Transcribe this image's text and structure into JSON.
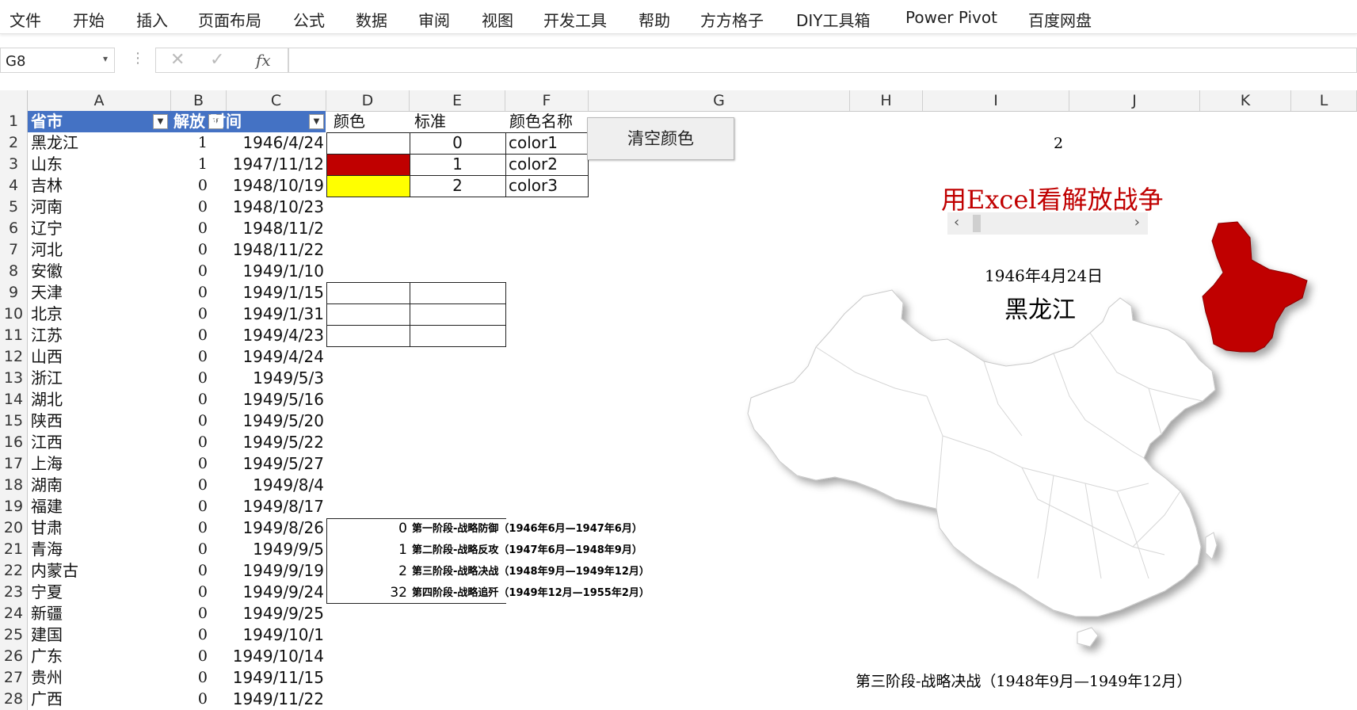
{
  "ribbon": {
    "tabs": [
      "文件",
      "开始",
      "插入",
      "页面布局",
      "公式",
      "数据",
      "审阅",
      "视图",
      "开发工具",
      "帮助",
      "方方格子",
      "DIY工具箱",
      "Power Pivot",
      "百度网盘"
    ]
  },
  "formula_bar": {
    "name_box": "G8",
    "fx": "fx",
    "formula": ""
  },
  "columns": [
    "A",
    "B",
    "C",
    "D",
    "E",
    "F",
    "G",
    "H",
    "I",
    "J",
    "K",
    "L"
  ],
  "rows": [
    "1",
    "2",
    "3",
    "4",
    "5",
    "6",
    "7",
    "8",
    "9",
    "10",
    "11",
    "12",
    "13",
    "14",
    "15",
    "16",
    "17",
    "18",
    "19",
    "20",
    "21",
    "22",
    "23",
    "24",
    "25",
    "26",
    "27",
    "28"
  ],
  "table": {
    "headers": [
      "省市",
      "解放",
      "时间",
      "颜色",
      "标准",
      "颜色名称"
    ],
    "data": [
      [
        "黑龙江",
        "1",
        "1946/4/24"
      ],
      [
        "山东",
        "1",
        "1947/11/12"
      ],
      [
        "吉林",
        "0",
        "1948/10/19"
      ],
      [
        "河南",
        "0",
        "1948/10/23"
      ],
      [
        "辽宁",
        "0",
        "1948/11/2"
      ],
      [
        "河北",
        "0",
        "1948/11/22"
      ],
      [
        "安徽",
        "0",
        "1949/1/10"
      ],
      [
        "天津",
        "0",
        "1949/1/15"
      ],
      [
        "北京",
        "0",
        "1949/1/31"
      ],
      [
        "江苏",
        "0",
        "1949/4/23"
      ],
      [
        "山西",
        "0",
        "1949/4/24"
      ],
      [
        "浙江",
        "0",
        "1949/5/3"
      ],
      [
        "湖北",
        "0",
        "1949/5/16"
      ],
      [
        "陕西",
        "0",
        "1949/5/20"
      ],
      [
        "江西",
        "0",
        "1949/5/22"
      ],
      [
        "上海",
        "0",
        "1949/5/27"
      ],
      [
        "湖南",
        "0",
        "1949/8/4"
      ],
      [
        "福建",
        "0",
        "1949/8/17"
      ],
      [
        "甘肃",
        "0",
        "1949/8/26"
      ],
      [
        "青海",
        "0",
        "1949/9/5"
      ],
      [
        "内蒙古",
        "0",
        "1949/9/19"
      ],
      [
        "宁夏",
        "0",
        "1949/9/24"
      ],
      [
        "新疆",
        "0",
        "1949/9/25"
      ],
      [
        "建国",
        "0",
        "1949/10/1"
      ],
      [
        "广东",
        "0",
        "1949/10/14"
      ],
      [
        "贵州",
        "0",
        "1949/11/15"
      ],
      [
        "广西",
        "0",
        "1949/11/22"
      ]
    ]
  },
  "color_table": {
    "rows": [
      {
        "standard": "0",
        "name": "color1",
        "fill": "#ffffff"
      },
      {
        "standard": "1",
        "name": "color2",
        "fill": "#c00000"
      },
      {
        "standard": "2",
        "name": "color3",
        "fill": "#ffff00"
      }
    ]
  },
  "stages": [
    {
      "value": "0",
      "label": "第一阶段-战略防御（1946年6月—1947年6月）"
    },
    {
      "value": "1",
      "label": "第二阶段-战略反攻（1947年6月—1948年9月）"
    },
    {
      "value": "2",
      "label": "第三阶段-战略决战（1948年9月—1949年12月）"
    },
    {
      "value": "32",
      "label": "第四阶段-战略追歼（1949年12月—1955年2月）"
    }
  ],
  "clear_button": "清空颜色",
  "map": {
    "counter": "2",
    "title": "用Excel看解放战争",
    "date": "1946年4月24日",
    "province": "黑龙江",
    "stage_caption": "第三阶段-战略决战（1948年9月—1949年12月）",
    "highlight_color": "#c00000"
  }
}
